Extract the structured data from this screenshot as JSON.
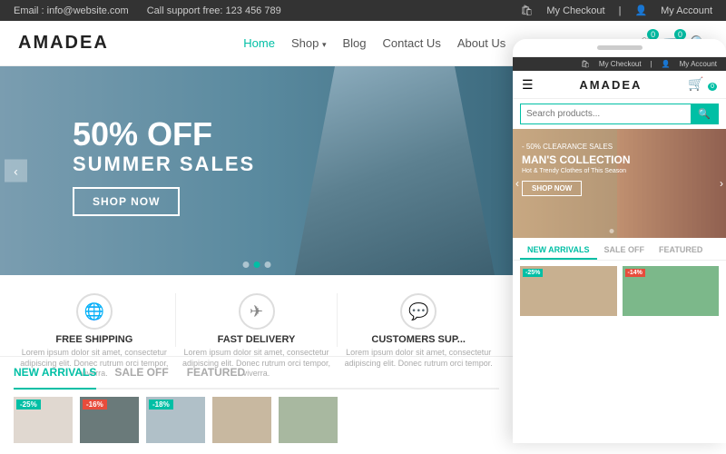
{
  "topbar": {
    "email_label": "Email : info@website.com",
    "phone_label": "Call support free: 123 456 789",
    "checkout_label": "My Checkout",
    "account_label": "My Account"
  },
  "header": {
    "logo": "AMADEA",
    "nav": {
      "home": "Home",
      "shop": "Shop",
      "blog": "Blog",
      "contact": "Contact Us",
      "about": "About Us"
    }
  },
  "hero": {
    "percent": "50% OFF",
    "subtitle": "SUMMER SALES",
    "cta": "SHOP NOW"
  },
  "features": [
    {
      "title": "FREE SHIPPING",
      "desc": "Lorem ipsum dolor sit amet, consectetur adipiscing elit. Donec rutrum orci tempor, viverra.",
      "icon": "🌐"
    },
    {
      "title": "FAST DELIVERY",
      "desc": "Lorem ipsum dolor sit amet, consectetur adipiscing elit. Donec rutrum orci tempor, viverra.",
      "icon": "✈"
    },
    {
      "title": "CUSTOMERS SUP...",
      "desc": "Lorem ipsum dolor sit amet, consectetur adipiscing elit. Donec rutrum orci tempor.",
      "icon": "💬"
    }
  ],
  "tabs": [
    "NEW ARRIVALS",
    "SALE OFF",
    "FEATURED"
  ],
  "products": [
    {
      "badge": "-25%",
      "badge_type": "teal"
    },
    {
      "badge": "-16%",
      "badge_type": "red"
    },
    {
      "badge": "-18%",
      "badge_type": "teal"
    }
  ],
  "mobile": {
    "top_bar": {
      "checkout": "My Checkout",
      "account": "My Account"
    },
    "logo": "AMADEA",
    "search_placeholder": "Search products...",
    "hero": {
      "clearance": "- 50% CLEARANCE SALES",
      "collection": "MAN'S COLLECTION",
      "sub": "Hot & Trendy Clothes of This Season",
      "cta": "SHOP NOW"
    },
    "tabs": [
      "NEW ARRIVALS",
      "SALE OFF",
      "FEATURED"
    ],
    "products": [
      {
        "badge": "-25%",
        "badge_type": "teal"
      },
      {
        "badge": "-14%",
        "badge_type": "red"
      }
    ]
  }
}
